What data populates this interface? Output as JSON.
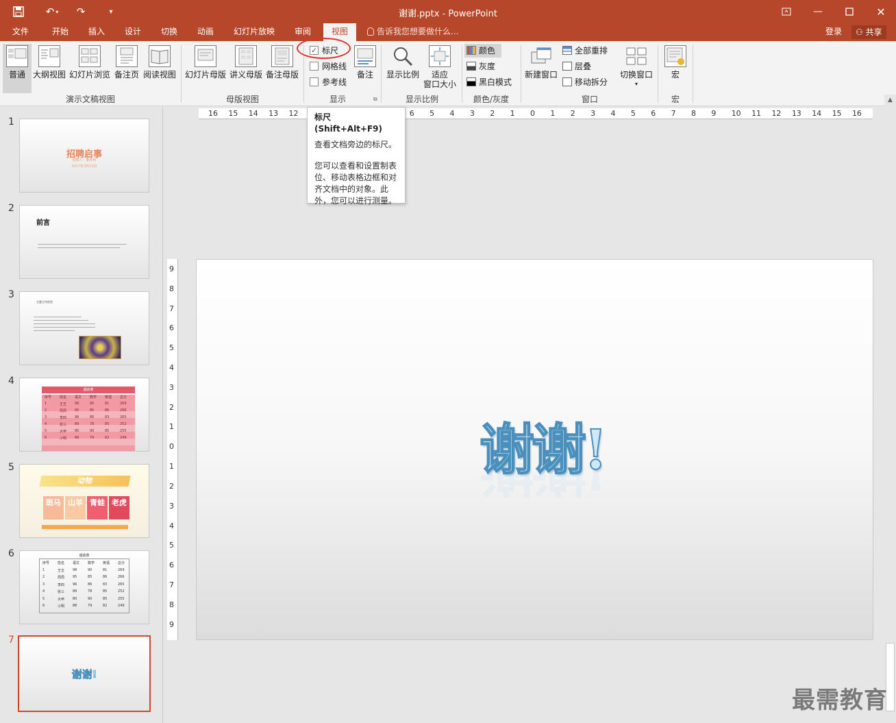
{
  "window": {
    "title": "谢谢.pptx - PowerPoint"
  },
  "tabs": {
    "file": "文件",
    "home": "开始",
    "insert": "插入",
    "design": "设计",
    "transitions": "切换",
    "animations": "动画",
    "slideshow": "幻灯片放映",
    "review": "审阅",
    "view": "视图",
    "tell_me": "告诉我您想要做什么...",
    "login": "登录",
    "share": "共享"
  },
  "ribbon": {
    "presentation_views": {
      "label": "演示文稿视图",
      "normal": "普通",
      "outline": "大纲视图",
      "sorter": "幻灯片浏览",
      "notes_page": "备注页",
      "reading": "阅读视图"
    },
    "master_views": {
      "label": "母版视图",
      "slide_master": "幻灯片母版",
      "handout_master": "讲义母版",
      "notes_master": "备注母版"
    },
    "show": {
      "label": "显示",
      "ruler": "标尺",
      "ruler_checked": true,
      "gridlines": "网格线",
      "guides": "参考线",
      "notes": "备注"
    },
    "zoom": {
      "label": "显示比例",
      "zoom": "显示比例",
      "fit_line1": "适应",
      "fit_line2": "窗口大小"
    },
    "color": {
      "label": "颜色/灰度",
      "color": "颜色",
      "grayscale": "灰度",
      "bw": "黑白模式"
    },
    "window": {
      "label": "窗口",
      "new_window": "新建窗口",
      "arrange_all": "全部重排",
      "cascade": "层叠",
      "move_split": "移动拆分",
      "switch_windows": "切换窗口"
    },
    "macros": {
      "label": "宏",
      "macros": "宏"
    }
  },
  "tooltip": {
    "title": "标尺 (Shift+Alt+F9)",
    "p1": "查看文档旁边的标尺。",
    "p2": "您可以查看和设置制表位、移动表格边框和对齐文档中的对象。此外，您可以进行测量。"
  },
  "slides": [
    {
      "num": "1",
      "title": "招聘启事",
      "sub1": "招聘人：某老师",
      "sub2": "2017年3月10日"
    },
    {
      "num": "2",
      "title": "前言"
    },
    {
      "num": "3",
      "title": "主要工作经验"
    },
    {
      "num": "4",
      "title": "成绩表"
    },
    {
      "num": "5",
      "title": "动物",
      "cells": [
        "斑马",
        "山羊",
        "青蛙",
        "老虎"
      ]
    },
    {
      "num": "6",
      "title": "成绩表"
    },
    {
      "num": "7",
      "title": "谢谢!"
    }
  ],
  "score_table": {
    "headers": [
      "序号",
      "姓名",
      "语文",
      "数学",
      "英语",
      "总分"
    ],
    "rows": [
      [
        "1",
        "王五",
        "98",
        "90",
        "81",
        "269"
      ],
      [
        "2",
        "周周",
        "95",
        "85",
        "86",
        "266"
      ],
      [
        "3",
        "李四",
        "96",
        "86",
        "83",
        "265"
      ],
      [
        "4",
        "张三",
        "89",
        "78",
        "85",
        "252"
      ],
      [
        "5",
        "大甲",
        "80",
        "90",
        "85",
        "255"
      ],
      [
        "6",
        "小明",
        "88",
        "79",
        "82",
        "249"
      ]
    ]
  },
  "main_slide": {
    "wordart": "谢谢!"
  },
  "ruler": {
    "h_ticks": [
      "16",
      "15",
      "14",
      "13",
      "12",
      "11",
      "10",
      "9",
      "8",
      "7",
      "6",
      "5",
      "4",
      "3",
      "2",
      "1",
      "0",
      "1",
      "2",
      "3",
      "4",
      "5",
      "6",
      "7",
      "8",
      "9",
      "10",
      "11",
      "12",
      "13",
      "14",
      "15",
      "16"
    ],
    "v_ticks": [
      "9",
      "8",
      "7",
      "6",
      "5",
      "4",
      "3",
      "2",
      "1",
      "0",
      "1",
      "2",
      "3",
      "4",
      "5",
      "6",
      "7",
      "8",
      "9"
    ]
  },
  "watermark": "最需教育",
  "colors": {
    "accent": "#b7472a",
    "selection": "#d24726"
  }
}
